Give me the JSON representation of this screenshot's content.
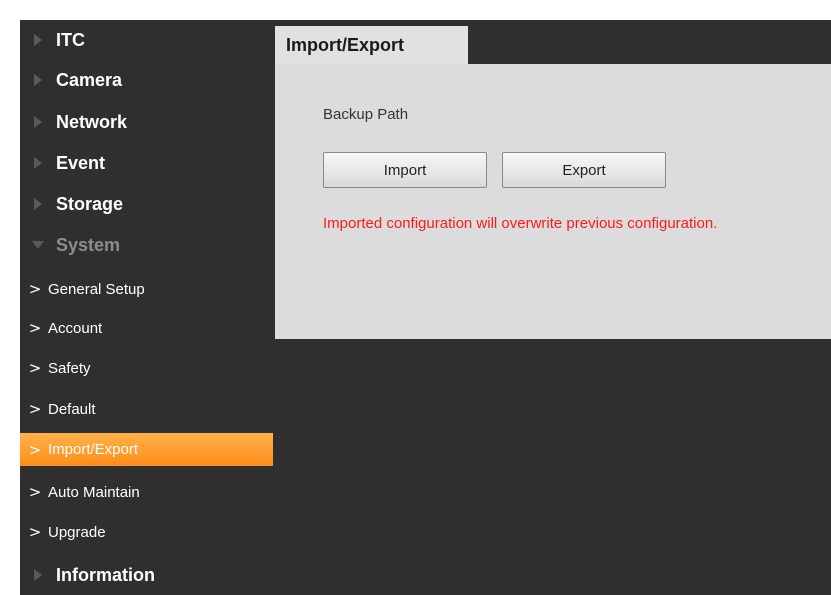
{
  "sidebar": {
    "items": [
      {
        "label": "ITC"
      },
      {
        "label": "Camera"
      },
      {
        "label": "Network"
      },
      {
        "label": "Event"
      },
      {
        "label": "Storage"
      },
      {
        "label": "System"
      },
      {
        "label": "Information"
      }
    ],
    "system_sub_items": [
      {
        "label": "General Setup"
      },
      {
        "label": "Account"
      },
      {
        "label": "Safety"
      },
      {
        "label": "Default"
      },
      {
        "label": "Import/Export"
      },
      {
        "label": "Auto Maintain"
      },
      {
        "label": "Upgrade"
      }
    ],
    "active_sub_item": "Import/Export",
    "active_color": "#ff9a2e"
  },
  "content": {
    "tab_label": "Import/Export",
    "backup_path_label": "Backup Path",
    "import_button": "Import",
    "export_button": "Export",
    "warning_text": "Imported configuration will overwrite previous configuration.",
    "warning_color": "#ff1a1a"
  }
}
